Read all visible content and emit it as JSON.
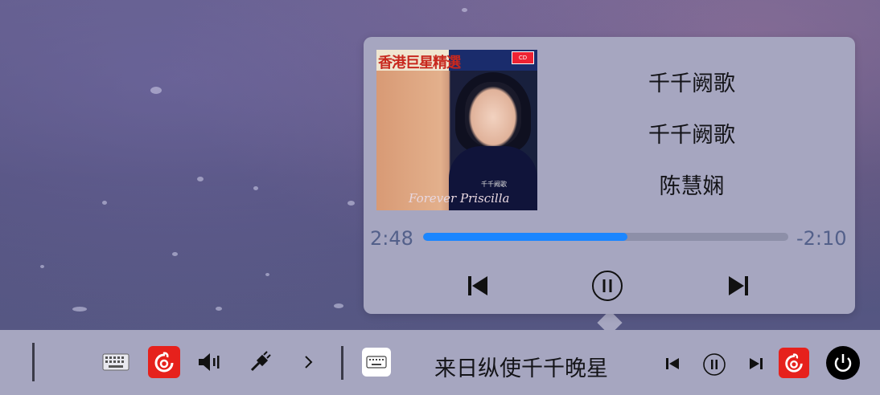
{
  "player_popup": {
    "song_title": "千千阙歌",
    "album": "千千阙歌",
    "artist": "陈慧娴",
    "elapsed": "2:48",
    "remaining": "-2:10",
    "progress_fraction": 0.56,
    "cover": {
      "title_text": "香港巨星精選",
      "signature_text": "Forever Priscilla",
      "small_label": "千千阙歌"
    },
    "controls": {
      "previous_icon": "skip-previous-icon",
      "pause_icon": "pause-circle-icon",
      "next_icon": "skip-next-icon"
    }
  },
  "taskbar": {
    "now_playing": "来日纵使千千晚星",
    "icons": {
      "keyboard": "keyboard-icon",
      "netease": "netease-music-icon",
      "volume": "volume-icon",
      "usb": "usb-icon",
      "expand": "chevron-right-icon",
      "ime": "input-method-keyboard-icon",
      "prev": "skip-previous-icon",
      "pause": "pause-circle-icon",
      "next": "skip-next-icon",
      "power": "power-icon"
    }
  },
  "colors": {
    "accent": "#1b86ff",
    "panel": "#a6a6c0",
    "netease_red": "#e6211c"
  }
}
